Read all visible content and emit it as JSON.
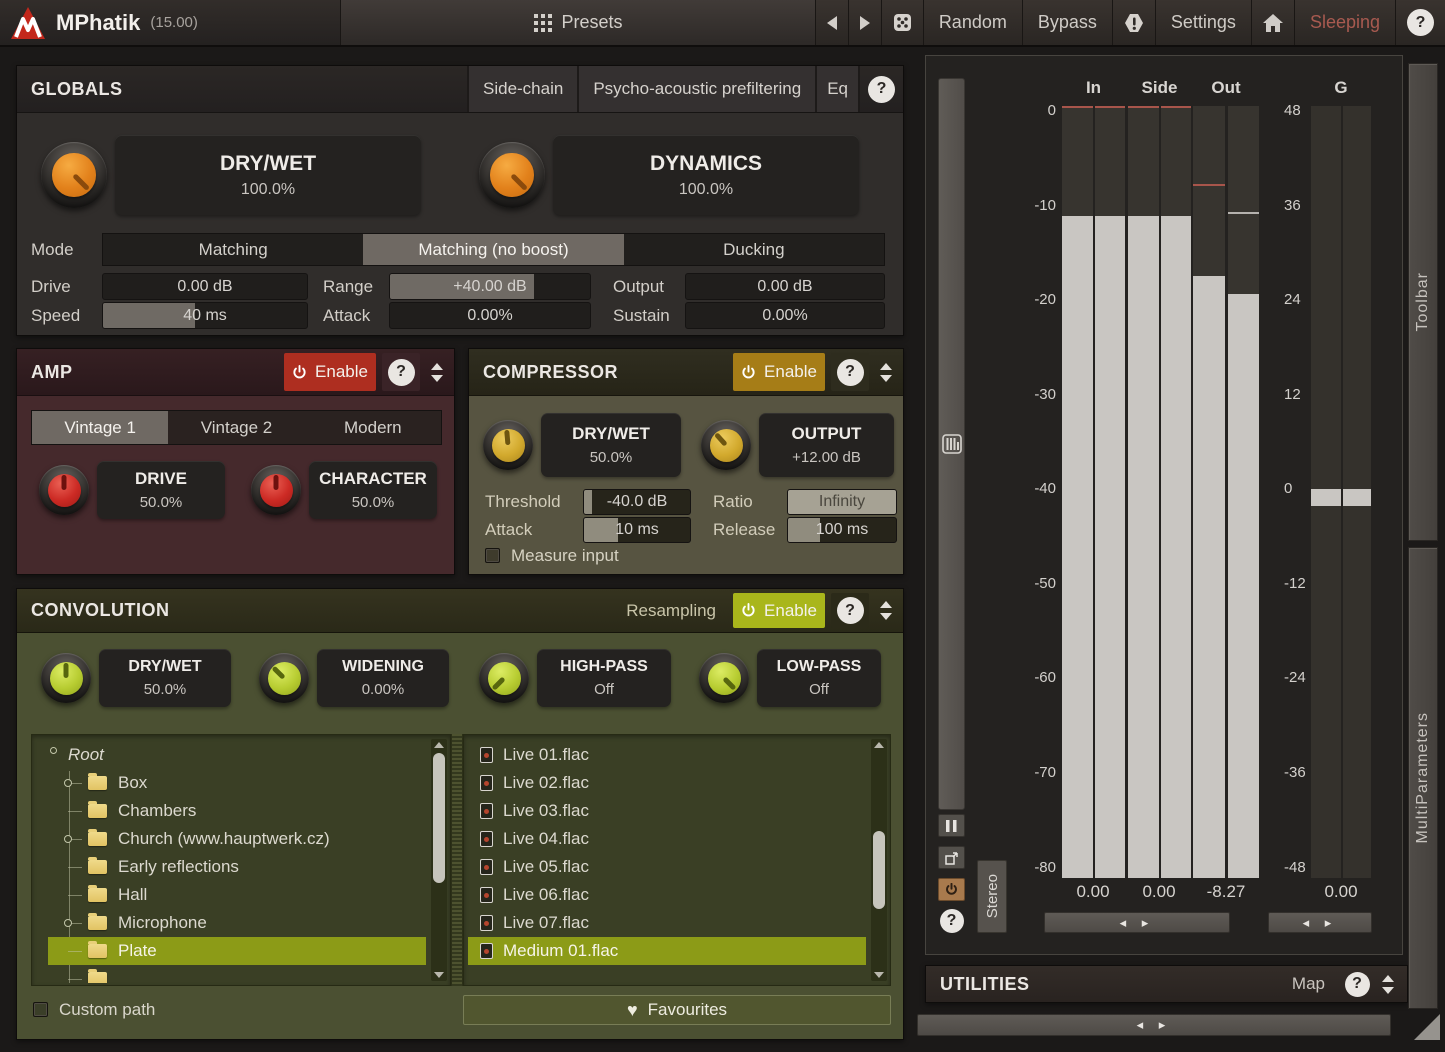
{
  "titlebar": {
    "title": "MPhatik",
    "version": "(15.00)",
    "presets": "Presets",
    "random": "Random",
    "bypass": "Bypass",
    "settings": "Settings",
    "sleeping": "Sleeping",
    "help": "?"
  },
  "globals": {
    "title": "GLOBALS",
    "sidechain": "Side-chain",
    "prefiltering": "Psycho-acoustic prefiltering",
    "eq": "Eq",
    "help": "?",
    "knobs": [
      {
        "label": "DRY/WET",
        "value": "100.0%"
      },
      {
        "label": "DYNAMICS",
        "value": "100.0%"
      }
    ],
    "mode_label": "Mode",
    "modes": [
      {
        "label": "Matching",
        "selected": false
      },
      {
        "label": "Matching (no boost)",
        "selected": true
      },
      {
        "label": "Ducking",
        "selected": false
      }
    ],
    "params": {
      "drive": {
        "label": "Drive",
        "value": "0.00 dB"
      },
      "range": {
        "label": "Range",
        "value": "+40.00 dB"
      },
      "output": {
        "label": "Output",
        "value": "0.00 dB"
      },
      "speed": {
        "label": "Speed",
        "value": "40 ms"
      },
      "attack": {
        "label": "Attack",
        "value": "0.00%"
      },
      "sustain": {
        "label": "Sustain",
        "value": "0.00%"
      }
    }
  },
  "amp": {
    "title": "AMP",
    "enable": "Enable",
    "help": "?",
    "tabs": [
      {
        "label": "Vintage 1",
        "selected": true
      },
      {
        "label": "Vintage 2",
        "selected": false
      },
      {
        "label": "Modern",
        "selected": false
      }
    ],
    "knobs": [
      {
        "label": "DRIVE",
        "value": "50.0%"
      },
      {
        "label": "CHARACTER",
        "value": "50.0%"
      }
    ]
  },
  "compressor": {
    "title": "COMPRESSOR",
    "enable": "Enable",
    "help": "?",
    "knobs": [
      {
        "label": "DRY/WET",
        "value": "50.0%"
      },
      {
        "label": "OUTPUT",
        "value": "+12.00 dB"
      }
    ],
    "params": {
      "threshold": {
        "label": "Threshold",
        "value": "-40.0 dB"
      },
      "ratio": {
        "label": "Ratio",
        "value": "Infinity"
      },
      "attack": {
        "label": "Attack",
        "value": "10 ms"
      },
      "release": {
        "label": "Release",
        "value": "100 ms"
      }
    },
    "measure_input": "Measure input"
  },
  "convolution": {
    "title": "CONVOLUTION",
    "resampling": "Resampling",
    "enable": "Enable",
    "help": "?",
    "knobs": [
      {
        "label": "DRY/WET",
        "value": "50.0%"
      },
      {
        "label": "WIDENING",
        "value": "0.00%"
      },
      {
        "label": "HIGH-PASS",
        "value": "Off"
      },
      {
        "label": "LOW-PASS",
        "value": "Off"
      }
    ],
    "tree": {
      "root": "Root",
      "items": [
        {
          "label": "Box",
          "expandable": true
        },
        {
          "label": "Chambers",
          "expandable": false
        },
        {
          "label": "Church (www.hauptwerk.cz)",
          "expandable": true
        },
        {
          "label": "Early reflections",
          "expandable": false
        },
        {
          "label": "Hall",
          "expandable": false
        },
        {
          "label": "Microphone",
          "expandable": true
        },
        {
          "label": "Plate",
          "expandable": false,
          "selected": true
        }
      ]
    },
    "files": [
      {
        "label": "Live 01.flac"
      },
      {
        "label": "Live 02.flac"
      },
      {
        "label": "Live 03.flac"
      },
      {
        "label": "Live 04.flac"
      },
      {
        "label": "Live 05.flac"
      },
      {
        "label": "Live 06.flac"
      },
      {
        "label": "Live 07.flac"
      },
      {
        "label": "Medium 01.flac",
        "selected": true
      }
    ],
    "custom_path": "Custom path",
    "favourites": "Favourites"
  },
  "meters": {
    "columns": [
      "In",
      "Side",
      "Out",
      "G"
    ],
    "scale_left": [
      "0",
      "-10",
      "-20",
      "-30",
      "-40",
      "-50",
      "-60",
      "-70",
      "-80"
    ],
    "scale_right": [
      "48",
      "36",
      "24",
      "12",
      "0",
      "-12",
      "-24",
      "-36",
      "-48"
    ],
    "readouts": [
      "0.00",
      "0.00",
      "-8.27",
      "0.00"
    ],
    "stereo": "Stereo",
    "slider_arrows": "◂ ▸"
  },
  "utilities": {
    "title": "UTILITIES",
    "map": "Map",
    "help": "?"
  },
  "side_tabs": {
    "toolbar": "Toolbar",
    "multiparameters": "MultiParameters"
  },
  "colors": {
    "accent_red": "#ae2e20",
    "accent_gold": "#a67d17",
    "accent_green": "#a9b61b",
    "accent_orange": "#e2811b",
    "selection_olive": "#8c9b17",
    "meter_fill": "#c9c6c2",
    "sleeping_text": "#a85a50"
  }
}
